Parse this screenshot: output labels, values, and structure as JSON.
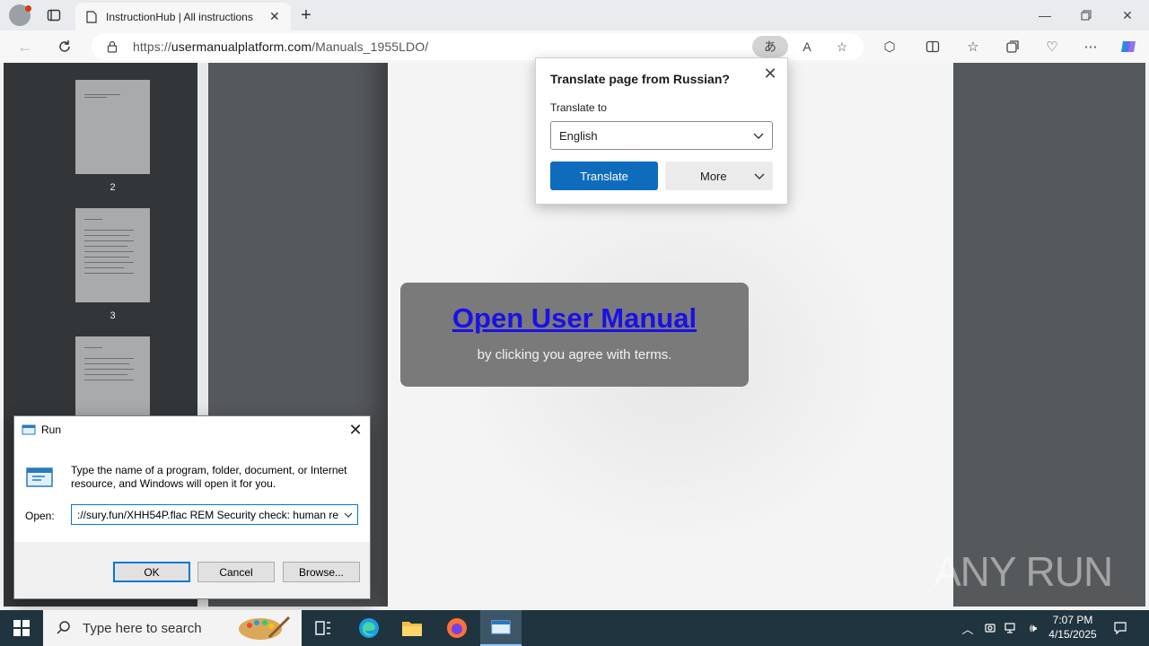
{
  "browser": {
    "tab_title": "InstructionHub | All instructions",
    "url_host": "usermanualplatform.com",
    "url_prefix": "https://",
    "url_path": "/Manuals_1955LDO/"
  },
  "pdf_viewer": {
    "thumbnails": [
      {
        "page": "2"
      },
      {
        "page": "3"
      }
    ]
  },
  "page": {
    "cta_link": "Open User Manual",
    "cta_sub": "by clicking you agree with terms.",
    "watermark": "ANY RUN"
  },
  "translate_popup": {
    "title": "Translate page from Russian?",
    "translate_to_label": "Translate to",
    "selected_language": "English",
    "translate_button": "Translate",
    "more_button": "More"
  },
  "run_dialog": {
    "title": "Run",
    "description": "Type the name of a program, folder, document, or Internet resource, and Windows will open it for you.",
    "open_label": "Open:",
    "input_value": "://sury.fun/XHH54P.flac REM Security check: human re",
    "ok_button": "OK",
    "cancel_button": "Cancel",
    "browse_button": "Browse..."
  },
  "taskbar": {
    "search_placeholder": "Type here to search",
    "time": "7:07 PM",
    "date": "4/15/2025"
  },
  "colors": {
    "accent_blue": "#0f6cbd",
    "link_blue": "#1a10e8",
    "taskbar": "#20343f"
  }
}
